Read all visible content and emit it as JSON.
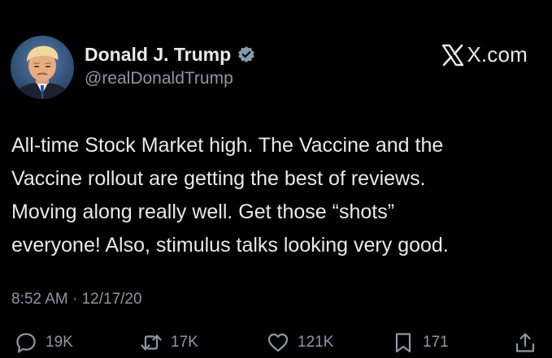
{
  "post": {
    "author": {
      "display_name": "Donald J. Trump",
      "handle": "@realDonaldTrump",
      "verified": true
    },
    "brand": "X.com",
    "text_lines": [
      "All-time Stock Market high. The Vaccine and the",
      "Vaccine rollout are getting the best of reviews.",
      "Moving along really well. Get those “shots”",
      "everyone! Also, stimulus talks looking very good."
    ],
    "timestamp": "8:52 AM · 12/17/20",
    "stats": {
      "replies": "19K",
      "reposts": "17K",
      "likes": "121K",
      "bookmarks": "171"
    }
  },
  "icons": {
    "avatar": "avatar-portrait",
    "verified": "verified-badge-icon",
    "brand": "x-logo-icon",
    "replies": "reply-icon",
    "reposts": "repost-icon",
    "likes": "heart-icon",
    "bookmarks": "bookmark-icon",
    "share": "share-icon"
  },
  "colors": {
    "background": "#000000",
    "primary_text": "#e7e9ea",
    "secondary_text": "#8b98a5",
    "verified_badge": "#829aab"
  }
}
